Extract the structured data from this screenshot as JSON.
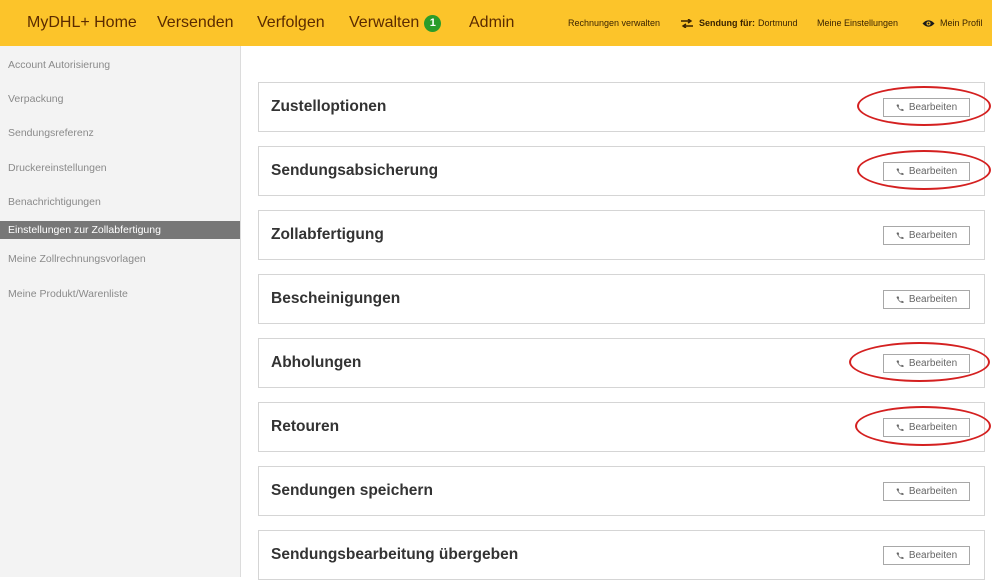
{
  "nav": {
    "home": "MyDHL+ Home",
    "ship": "Versenden",
    "track": "Verfolgen",
    "manage": "Verwalten",
    "manage_badge": "1",
    "admin": "Admin"
  },
  "utility": {
    "invoices": "Rechnungen verwalten",
    "shipment_for_label": "Sendung für:",
    "shipment_for_value": "Dortmund",
    "my_settings": "Meine Einstellungen",
    "my_profile": "Mein Profil"
  },
  "sidebar": {
    "items": [
      {
        "label": "Account Autorisierung",
        "active": false
      },
      {
        "label": "Verpackung",
        "active": false
      },
      {
        "label": "Sendungsreferenz",
        "active": false
      },
      {
        "label": "Druckereinstellungen",
        "active": false
      },
      {
        "label": "Benachrichtigungen",
        "active": false
      },
      {
        "label": "Einstellungen zur Zollabfertigung",
        "active": true
      },
      {
        "label": "Meine Zollrechnungsvorlagen",
        "active": false
      },
      {
        "label": "Meine Produkt/Warenliste",
        "active": false
      }
    ]
  },
  "sections": [
    {
      "title": "Zustelloptionen",
      "edit_label": "Bearbeiten",
      "highlighted": true
    },
    {
      "title": "Sendungsabsicherung",
      "edit_label": "Bearbeiten",
      "highlighted": true
    },
    {
      "title": "Zollabfertigung",
      "edit_label": "Bearbeiten",
      "highlighted": false
    },
    {
      "title": "Bescheinigungen",
      "edit_label": "Bearbeiten",
      "highlighted": false
    },
    {
      "title": "Abholungen",
      "edit_label": "Bearbeiten",
      "highlighted": true
    },
    {
      "title": "Retouren",
      "edit_label": "Bearbeiten",
      "highlighted": true
    },
    {
      "title": "Sendungen speichern",
      "edit_label": "Bearbeiten",
      "highlighted": false
    },
    {
      "title": "Sendungsbearbeitung übergeben",
      "edit_label": "Bearbeiten",
      "highlighted": false
    }
  ],
  "colors": {
    "brand_yellow": "#fcc42a",
    "nav_text": "#5b2b00",
    "badge_green": "#2a9c2a",
    "active_sidebar": "#777777",
    "annotation_red": "#d42020"
  },
  "icons": {
    "shipment_for": "ship-route-icon",
    "profile": "eye-icon",
    "edit": "phone-icon"
  }
}
